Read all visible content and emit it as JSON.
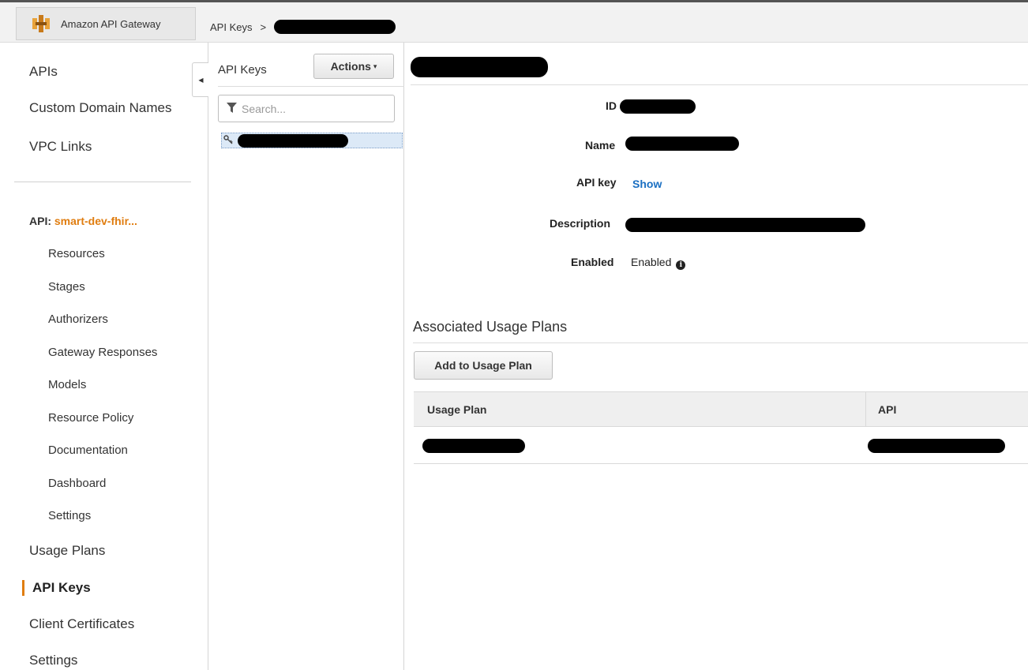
{
  "topbar": {
    "brand": "Amazon API Gateway",
    "breadcrumb_root": "API Keys",
    "breadcrumb_sep": ">"
  },
  "leftnav": {
    "items_top": [
      "APIs",
      "Custom Domain Names",
      "VPC Links"
    ],
    "api_prefix": "API:",
    "api_name": "smart-dev-fhir...",
    "sub_items": [
      "Resources",
      "Stages",
      "Authorizers",
      "Gateway Responses",
      "Models",
      "Resource Policy",
      "Documentation",
      "Dashboard",
      "Settings"
    ],
    "items_bottom": [
      "Usage Plans",
      "API Keys",
      "Client Certificates",
      "Settings"
    ],
    "active": "API Keys"
  },
  "midpanel": {
    "title": "API Keys",
    "actions_label": "Actions",
    "search_placeholder": "Search..."
  },
  "detail": {
    "fields": {
      "id_label": "ID",
      "name_label": "Name",
      "apikey_label": "API key",
      "apikey_value": "Show",
      "description_label": "Description",
      "enabled_label": "Enabled",
      "enabled_value": "Enabled"
    },
    "usage_section_title": "Associated Usage Plans",
    "add_button": "Add to Usage Plan",
    "table_headers": [
      "Usage Plan",
      "API"
    ]
  },
  "colors": {
    "accent_orange": "#e07d10",
    "link_blue": "#1a6fc2",
    "selection_bg": "#dce9f7"
  },
  "icons": {
    "brand_logo": "api-gateway-logo-icon",
    "collapse": "caret-left-icon",
    "search": "funnel-icon",
    "key": "key-icon",
    "info": "info-circle-icon",
    "dropdown": "caret-down-icon"
  }
}
